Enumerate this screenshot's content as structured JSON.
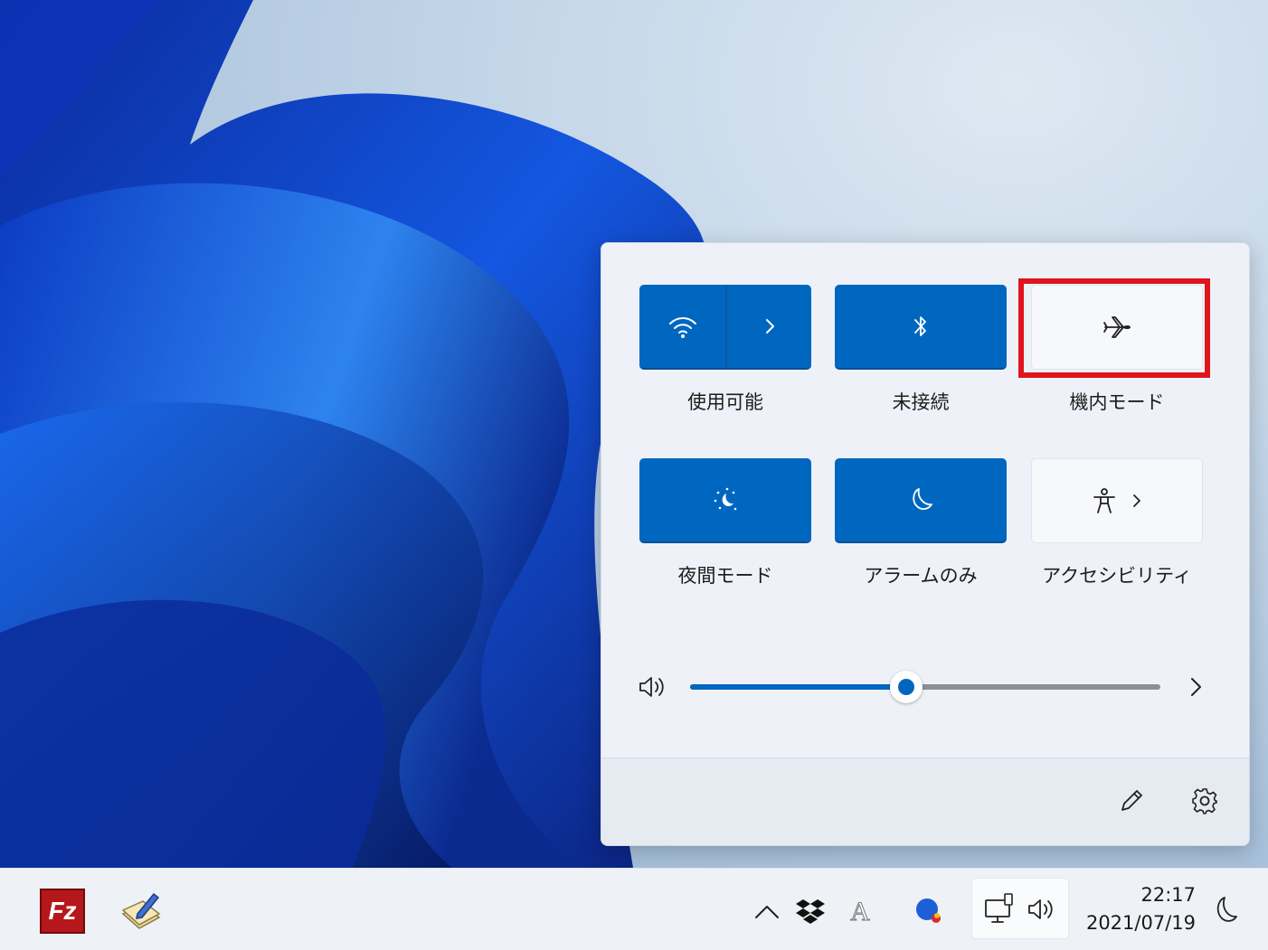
{
  "quick_settings": {
    "tiles": [
      {
        "id": "wifi",
        "label": "使用可能",
        "state": "on",
        "icon": "wifi-icon",
        "has_expand": true
      },
      {
        "id": "bluetooth",
        "label": "未接続",
        "state": "on",
        "icon": "bluetooth-icon",
        "has_expand": false
      },
      {
        "id": "airplane",
        "label": "機内モード",
        "state": "off",
        "icon": "airplane-icon",
        "has_expand": false,
        "highlighted": true
      },
      {
        "id": "night-light",
        "label": "夜間モード",
        "state": "on",
        "icon": "night-light-icon",
        "has_expand": false
      },
      {
        "id": "focus-assist",
        "label": "アラームのみ",
        "state": "on",
        "icon": "moon-icon",
        "has_expand": false
      },
      {
        "id": "accessibility",
        "label": "アクセシビリティ",
        "state": "off",
        "icon": "accessibility-icon",
        "has_expand": true
      }
    ],
    "volume": {
      "icon": "speaker-icon",
      "level": 0.46,
      "expand_icon": "chevron-right-icon"
    },
    "footer": {
      "edit_icon": "pencil-icon",
      "settings_icon": "gear-icon"
    }
  },
  "taskbar": {
    "pinned_apps": [
      {
        "id": "filezilla",
        "icon": "filezilla-icon",
        "text": "Fz"
      },
      {
        "id": "notepad-app",
        "icon": "notepad-pencil-icon"
      }
    ],
    "tray": {
      "overflow_icon": "chevron-up-icon",
      "dropbox_icon": "dropbox-icon",
      "ime_indicator": "A",
      "assistant_icon": "colored-dot-icon",
      "network_icon": "network-icon",
      "volume_icon": "speaker-icon"
    },
    "clock": {
      "time": "22:17",
      "date": "2021/07/19"
    },
    "focus_icon": "moon-icon"
  },
  "colors": {
    "accent": "#0067c0",
    "highlight": "#e0141c",
    "panel_bg": "#eef2f8"
  }
}
